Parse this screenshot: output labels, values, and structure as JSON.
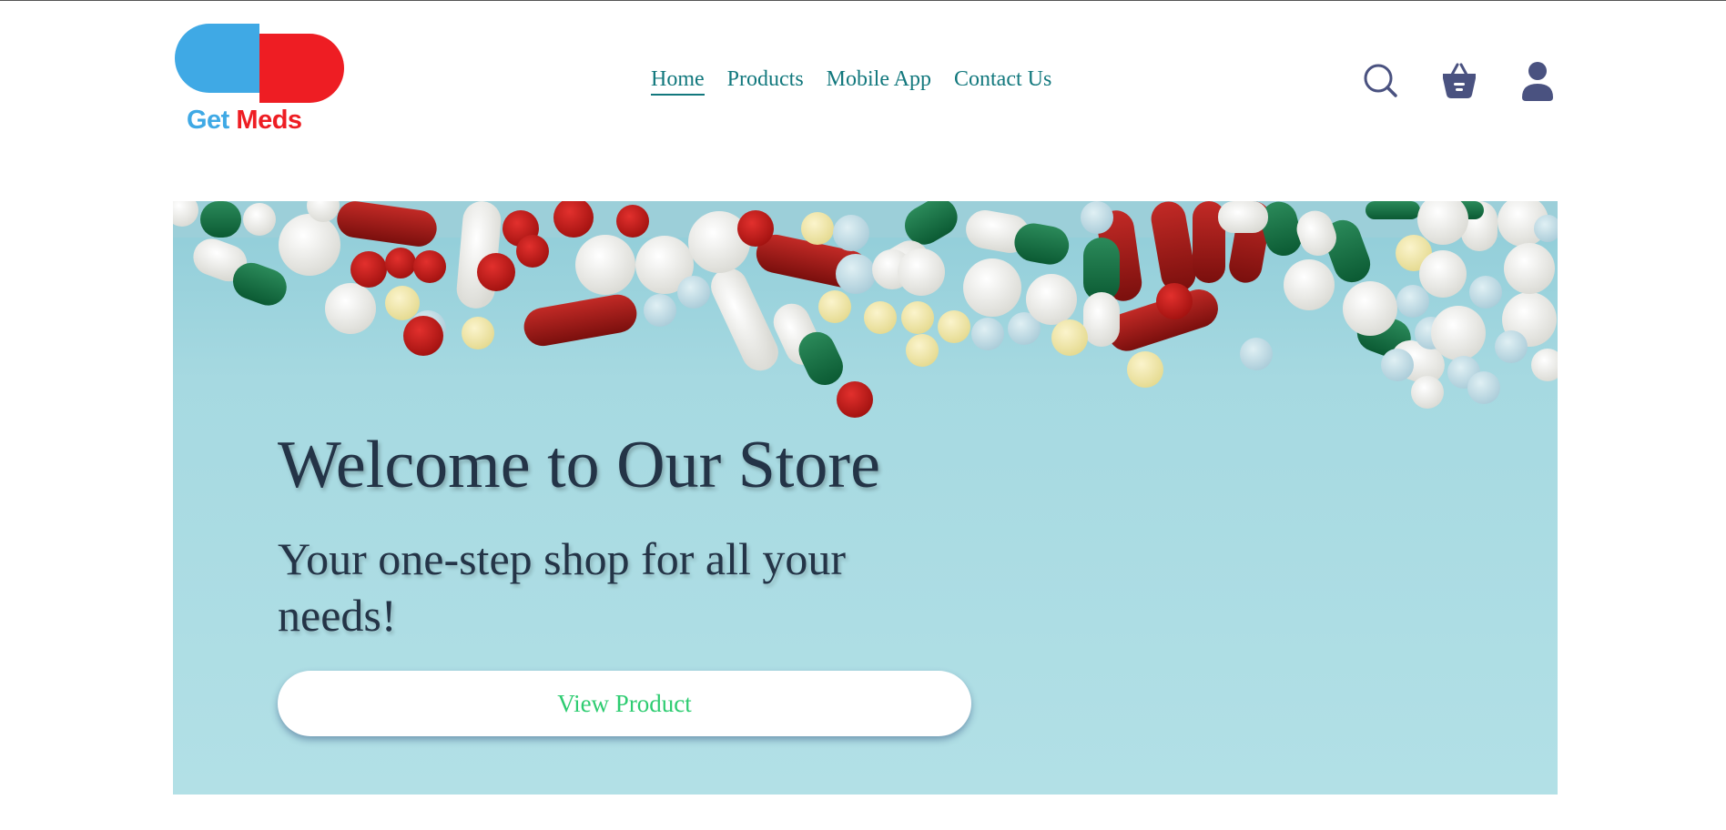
{
  "logo": {
    "text_part1": "Get",
    "text_part2": "Meds",
    "colors": {
      "blue": "#3fa9e5",
      "red": "#ee1d23"
    }
  },
  "nav": {
    "items": [
      {
        "label": "Home",
        "active": true
      },
      {
        "label": "Products",
        "active": false
      },
      {
        "label": "Mobile App",
        "active": false
      },
      {
        "label": "Contact Us",
        "active": false
      }
    ],
    "color": "#12787d"
  },
  "header_icons": [
    "search-icon",
    "basket-icon",
    "user-icon"
  ],
  "hero": {
    "title": "Welcome to Our Store",
    "subtitle": "Your one-step shop for all your needs!",
    "button_label": "View Product",
    "button_text_color": "#2ecc71",
    "background_color": "#b2e0e6"
  }
}
